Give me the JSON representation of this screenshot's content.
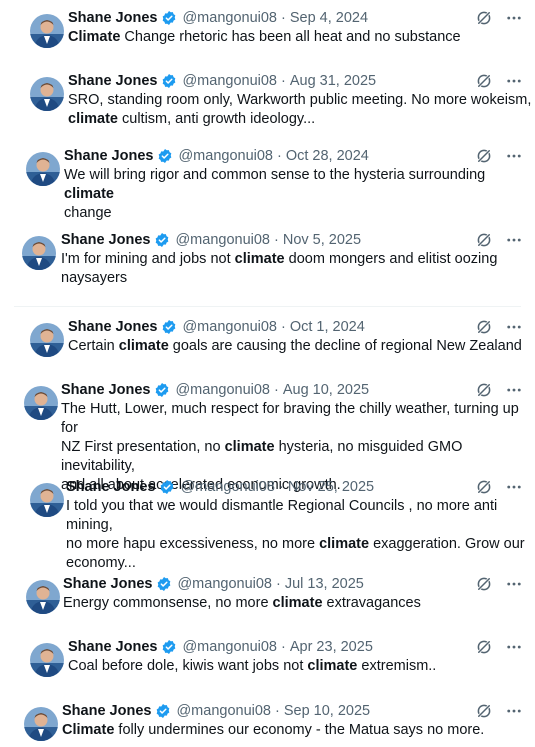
{
  "tweets": [
    {
      "name": "Shane Jones",
      "handle": "@mangonui08",
      "sep": "·",
      "date": "Sep 4, 2024",
      "lines": [
        [
          {
            "t": "Climate",
            "b": true
          },
          {
            "t": " Change rhetoric has been all heat and no substance",
            "b": false
          }
        ]
      ]
    },
    {
      "name": "Shane Jones",
      "handle": "@mangonui08",
      "sep": "·",
      "date": "Aug 31, 2025",
      "lines": [
        [
          {
            "t": "SRO, standing room only, Warkworth public meeting. No more wokeism,",
            "b": false
          }
        ],
        [
          {
            "t": "climate",
            "b": true
          },
          {
            "t": " cultism, anti growth ideology...",
            "b": false
          }
        ]
      ]
    },
    {
      "name": "Shane Jones",
      "handle": "@mangonui08",
      "sep": "·",
      "date": "Oct 28, 2024",
      "lines": [
        [
          {
            "t": "We will bring rigor and common sense to the hysteria surrounding ",
            "b": false
          },
          {
            "t": "climate",
            "b": true
          }
        ],
        [
          {
            "t": "change",
            "b": false
          }
        ]
      ]
    },
    {
      "name": "Shane Jones",
      "handle": "@mangonui08",
      "sep": "·",
      "date": "Nov 5, 2025",
      "lines": [
        [
          {
            "t": "I'm for mining and jobs not ",
            "b": false
          },
          {
            "t": "climate",
            "b": true
          },
          {
            "t": " doom mongers and elitist oozing",
            "b": false
          }
        ],
        [
          {
            "t": "naysayers",
            "b": false
          }
        ]
      ]
    },
    {
      "name": "Shane Jones",
      "handle": "@mangonui08",
      "sep": "·",
      "date": "Oct 1, 2024",
      "lines": [
        [
          {
            "t": "Certain ",
            "b": false
          },
          {
            "t": "climate",
            "b": true
          },
          {
            "t": " goals are causing the decline of regional New Zealand",
            "b": false
          }
        ]
      ]
    },
    {
      "name": "Shane Jones",
      "handle": "@mangonui08",
      "sep": "·",
      "date": "Aug 10, 2025",
      "lines": [
        [
          {
            "t": "The Hutt, Lower, much respect for braving the chilly weather, turning up for",
            "b": false
          }
        ],
        [
          {
            "t": "NZ First presentation, no ",
            "b": false
          },
          {
            "t": "climate",
            "b": true
          },
          {
            "t": " hysteria, no misguided GMO inevitability,",
            "b": false
          }
        ],
        [
          {
            "t": "and all about accelerated economic growth.",
            "b": false
          }
        ]
      ]
    },
    {
      "name": "Shane Jones",
      "handle": "@mangonui08",
      "sep": "·",
      "date": "Nov 25, 2025",
      "lines": [
        [
          {
            "t": "I told you that we would dismantle Regional Councils , no more anti mining,",
            "b": false
          }
        ],
        [
          {
            "t": "no more hapu excessiveness, no more ",
            "b": false
          },
          {
            "t": "climate",
            "b": true
          },
          {
            "t": " exaggeration. Grow our",
            "b": false
          }
        ],
        [
          {
            "t": "economy...",
            "b": false
          }
        ]
      ]
    },
    {
      "name": "Shane Jones",
      "handle": "@mangonui08",
      "sep": "·",
      "date": "Jul 13, 2025",
      "lines": [
        [
          {
            "t": "Energy commonsense, no more ",
            "b": false
          },
          {
            "t": "climate",
            "b": true
          },
          {
            "t": " extravagances",
            "b": false
          }
        ]
      ]
    },
    {
      "name": "Shane Jones",
      "handle": "@mangonui08",
      "sep": "·",
      "date": "Apr 23, 2025",
      "lines": [
        [
          {
            "t": "Coal before dole, kiwis want jobs not ",
            "b": false
          },
          {
            "t": "climate",
            "b": true
          },
          {
            "t": " extremism..",
            "b": false
          }
        ]
      ]
    },
    {
      "name": "Shane Jones",
      "handle": "@mangonui08",
      "sep": "·",
      "date": "Sep 10, 2025",
      "lines": [
        [
          {
            "t": "Climate",
            "b": true
          },
          {
            "t": " folly undermines our economy - the Matua says no more.",
            "b": false
          }
        ]
      ]
    }
  ],
  "icons": {
    "verified": "verified-badge-icon",
    "grok": "grok-icon",
    "more": "more-options-icon"
  },
  "colors": {
    "verified": "#1d9bf0",
    "secondary": "#536471",
    "divider": "#eff3f4",
    "avatar_bg": "#3a6ea5"
  }
}
